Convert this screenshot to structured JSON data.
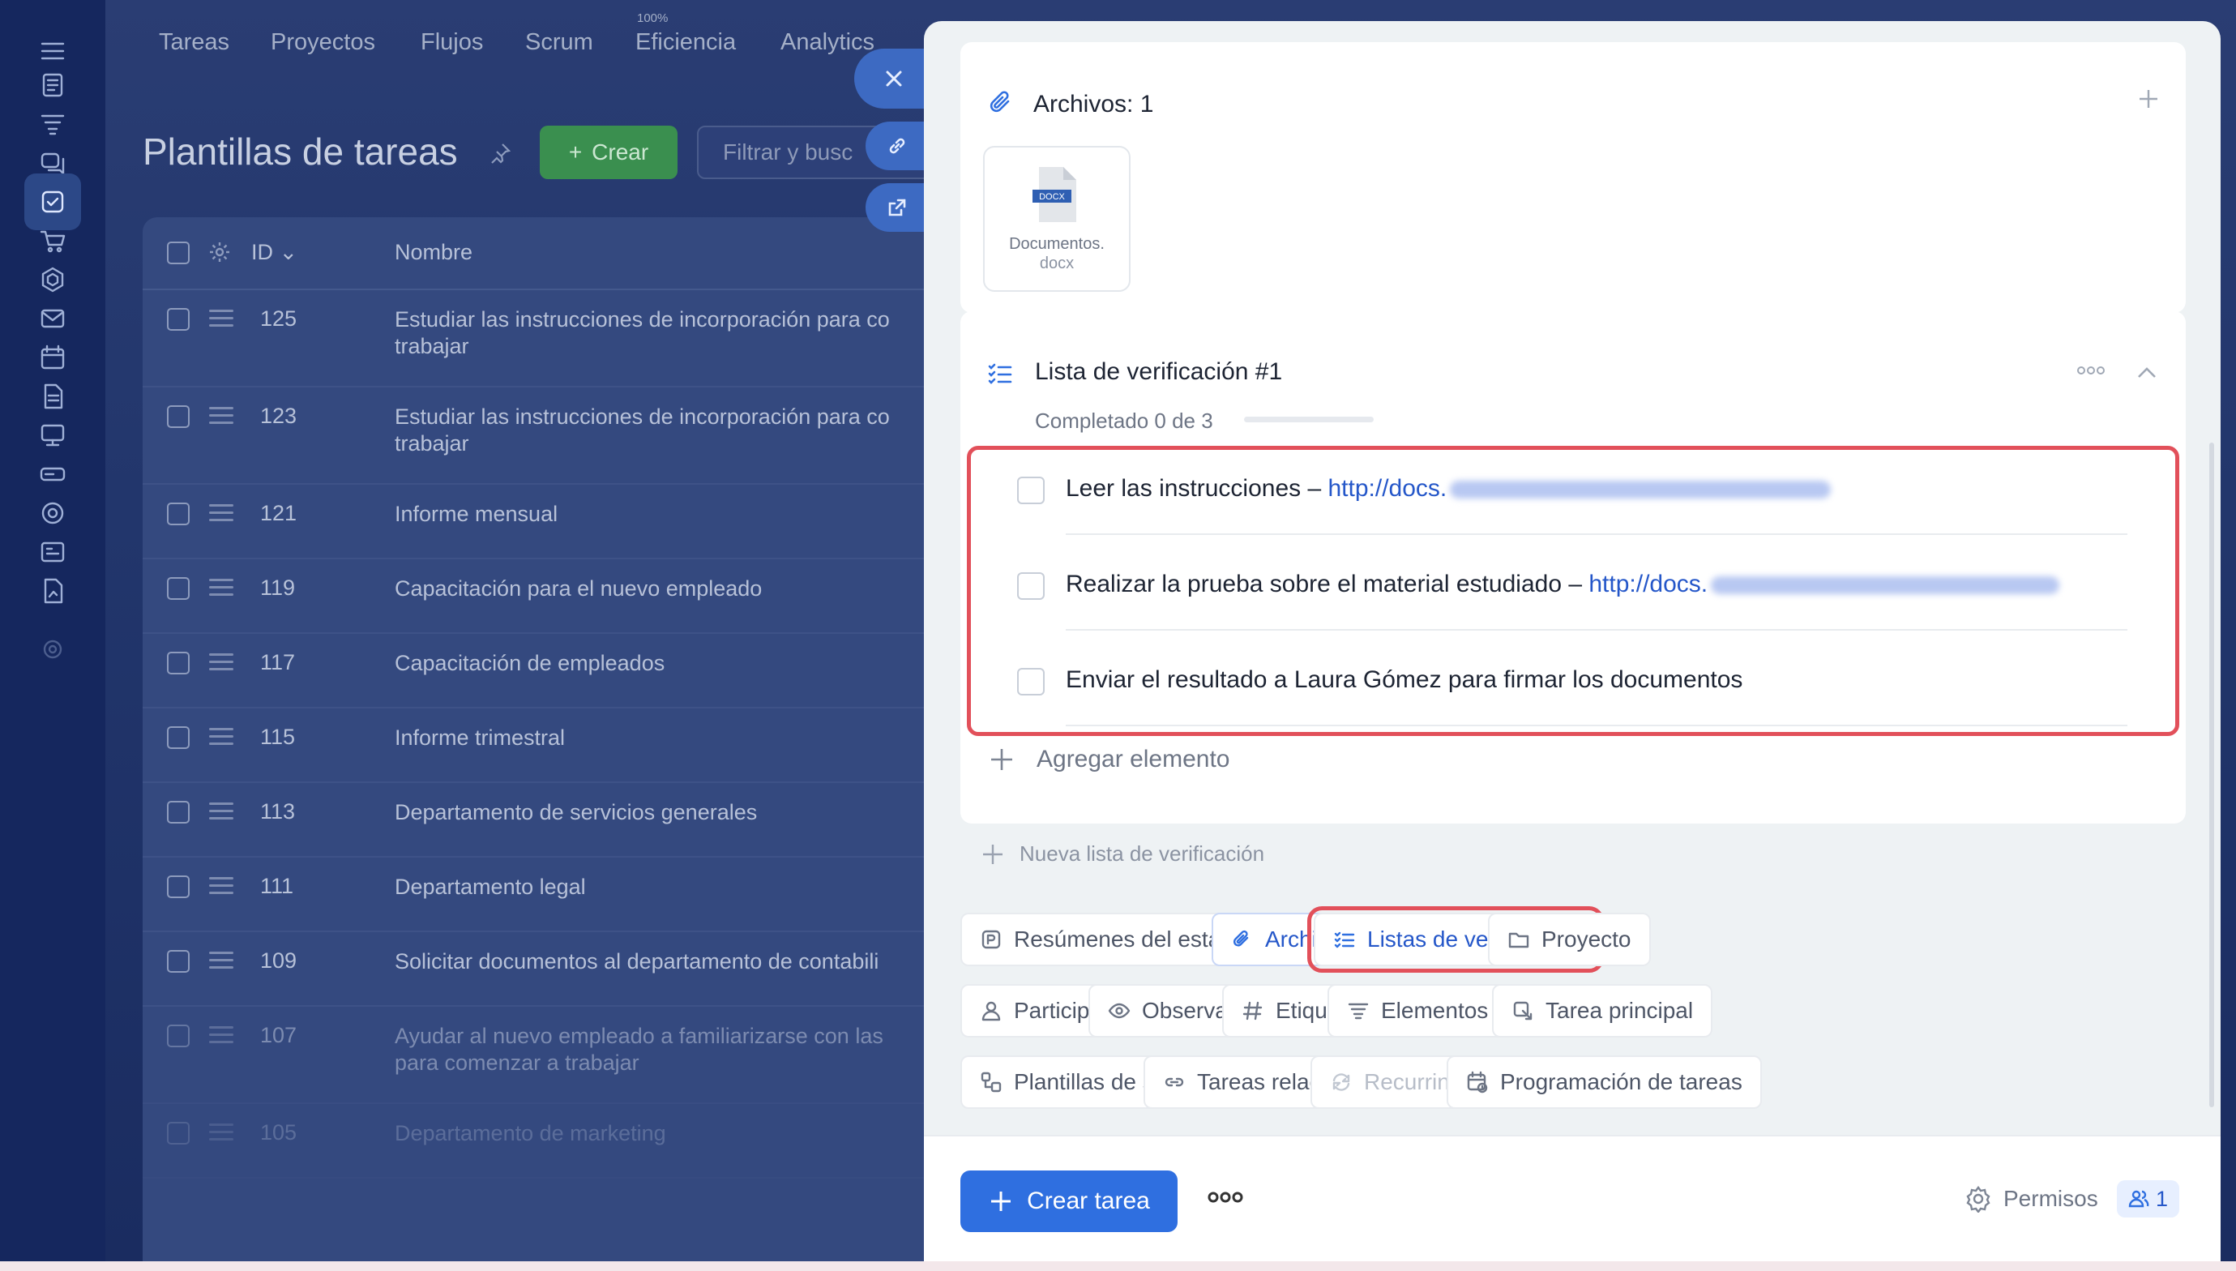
{
  "topnav": {
    "items": [
      "Tareas",
      "Proyectos",
      "Flujos",
      "Scrum",
      "Eficiencia",
      "Analytics"
    ],
    "efficiency_badge": "100%"
  },
  "page": {
    "title": "Plantillas de tareas",
    "create_label": "Crear",
    "filter_placeholder": "Filtrar y busc"
  },
  "table": {
    "columns": {
      "id": "ID",
      "name": "Nombre"
    },
    "rows": [
      {
        "id": "125",
        "name": "Estudiar las instrucciones de incorporación para co",
        "name2": "trabajar"
      },
      {
        "id": "123",
        "name": "Estudiar las instrucciones de incorporación para co",
        "name2": "trabajar"
      },
      {
        "id": "121",
        "name": "Informe mensual",
        "name2": ""
      },
      {
        "id": "119",
        "name": "Capacitación para el nuevo empleado",
        "name2": ""
      },
      {
        "id": "117",
        "name": "Capacitación de empleados",
        "name2": ""
      },
      {
        "id": "115",
        "name": "Informe trimestral",
        "name2": ""
      },
      {
        "id": "113",
        "name": "Departamento de servicios generales",
        "name2": ""
      },
      {
        "id": "111",
        "name": "Departamento legal",
        "name2": ""
      },
      {
        "id": "109",
        "name": "Solicitar documentos al departamento de contabili",
        "name2": ""
      },
      {
        "id": "107",
        "name": "Ayudar al nuevo empleado a familiarizarse con las",
        "name2": "para comenzar a trabajar"
      },
      {
        "id": "105",
        "name": "Departamento de marketing",
        "name2": ""
      }
    ]
  },
  "files": {
    "title": "Archivos: 1",
    "file": {
      "name_line1": "Documentos.",
      "name_line2": "docx",
      "type_label": "DOCX"
    }
  },
  "checklist": {
    "title": "Lista de verificación #1",
    "progress_text": "Completado 0 de 3",
    "progress": 0,
    "items": [
      {
        "text": "Leer las instrucciones – ",
        "link": "http://docs."
      },
      {
        "text": "Realizar la prueba sobre el material estudiado – ",
        "link": "http://docs."
      },
      {
        "text": "Enviar el resultado a Laura Gómez para firmar los documentos",
        "link": ""
      }
    ],
    "add_item": "Agregar elemento",
    "new_list": "Nueva lista de verificación"
  },
  "chips": [
    "Resúmenes del estado de la tarea",
    "Archivos",
    "Listas de verificación",
    "Proyecto",
    "Participantes",
    "Observadores",
    "Etiquetas",
    "Elementos del CRM",
    "Tarea principal",
    "Plantillas de subtareas",
    "Tareas relacionadas",
    "Recurring task",
    "Programación de tareas"
  ],
  "footer": {
    "create_task": "Crear tarea",
    "permissions": "Permisos",
    "user_count": "1"
  },
  "colors": {
    "accent": "#2f6fe0",
    "highlight": "#e2505a",
    "create_green": "#3a8f4f"
  }
}
